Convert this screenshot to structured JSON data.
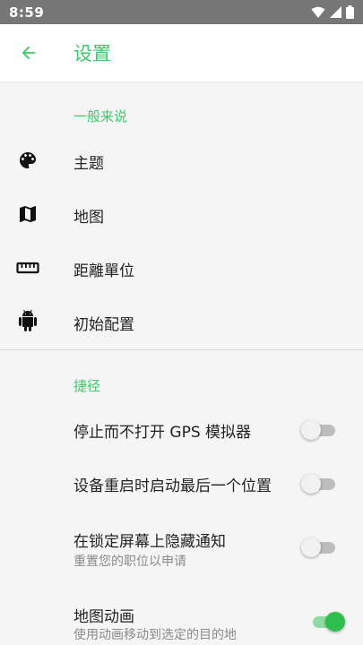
{
  "status_bar": {
    "time": "8:59"
  },
  "app_bar": {
    "title": "设置"
  },
  "sections": {
    "general": {
      "header": "一般来说",
      "items": [
        {
          "label": "主题",
          "icon": "palette-icon"
        },
        {
          "label": "地图",
          "icon": "map-icon"
        },
        {
          "label": "距離單位",
          "icon": "ruler-icon"
        },
        {
          "label": "初始配置",
          "icon": "android-icon"
        }
      ]
    },
    "shortcuts": {
      "header": "捷径",
      "items": [
        {
          "label": "停止而不打开 GPS 模拟器",
          "enabled": false
        },
        {
          "label": "设备重启时启动最后一个位置",
          "enabled": false
        },
        {
          "label": "在锁定屏幕上隐藏通知",
          "sublabel": "重置您的职位以申请",
          "enabled": false
        },
        {
          "label": "地图动画",
          "sublabel": "使用动画移动到选定的目的地",
          "enabled": true
        }
      ]
    }
  },
  "colors": {
    "accent": "#3ec86a",
    "switch_on": "#2dbe4e",
    "status_bar": "#777777"
  }
}
